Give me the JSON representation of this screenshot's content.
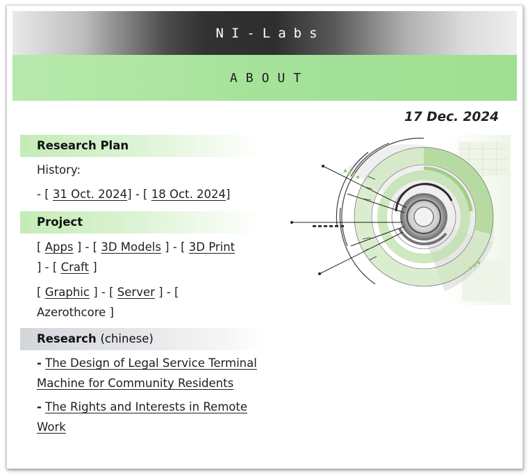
{
  "site": {
    "title": "NI-Labs",
    "section": "ABOUT",
    "date": "17 Dec. 2024"
  },
  "research_plan": {
    "heading": "Research Plan",
    "history_label": "History:",
    "links": [
      "31 Oct. 2024",
      "18 Oct. 2024"
    ]
  },
  "project": {
    "heading": "Project",
    "links": [
      "Apps",
      "3D Models",
      "3D Print",
      "Craft",
      "Graphic",
      "Server",
      "Azerothcore"
    ]
  },
  "research": {
    "heading": "Research",
    "heading_note": "(chinese)",
    "papers": [
      "The Design of  Legal Service Terminal Machine for Community Residents",
      "The Rights and Interests in Remote Work"
    ]
  },
  "colors": {
    "accent_green": "#a6e29a",
    "banner_dark": "#323232"
  },
  "hero_image": {
    "icon": "tech-circle-graphic-icon"
  }
}
